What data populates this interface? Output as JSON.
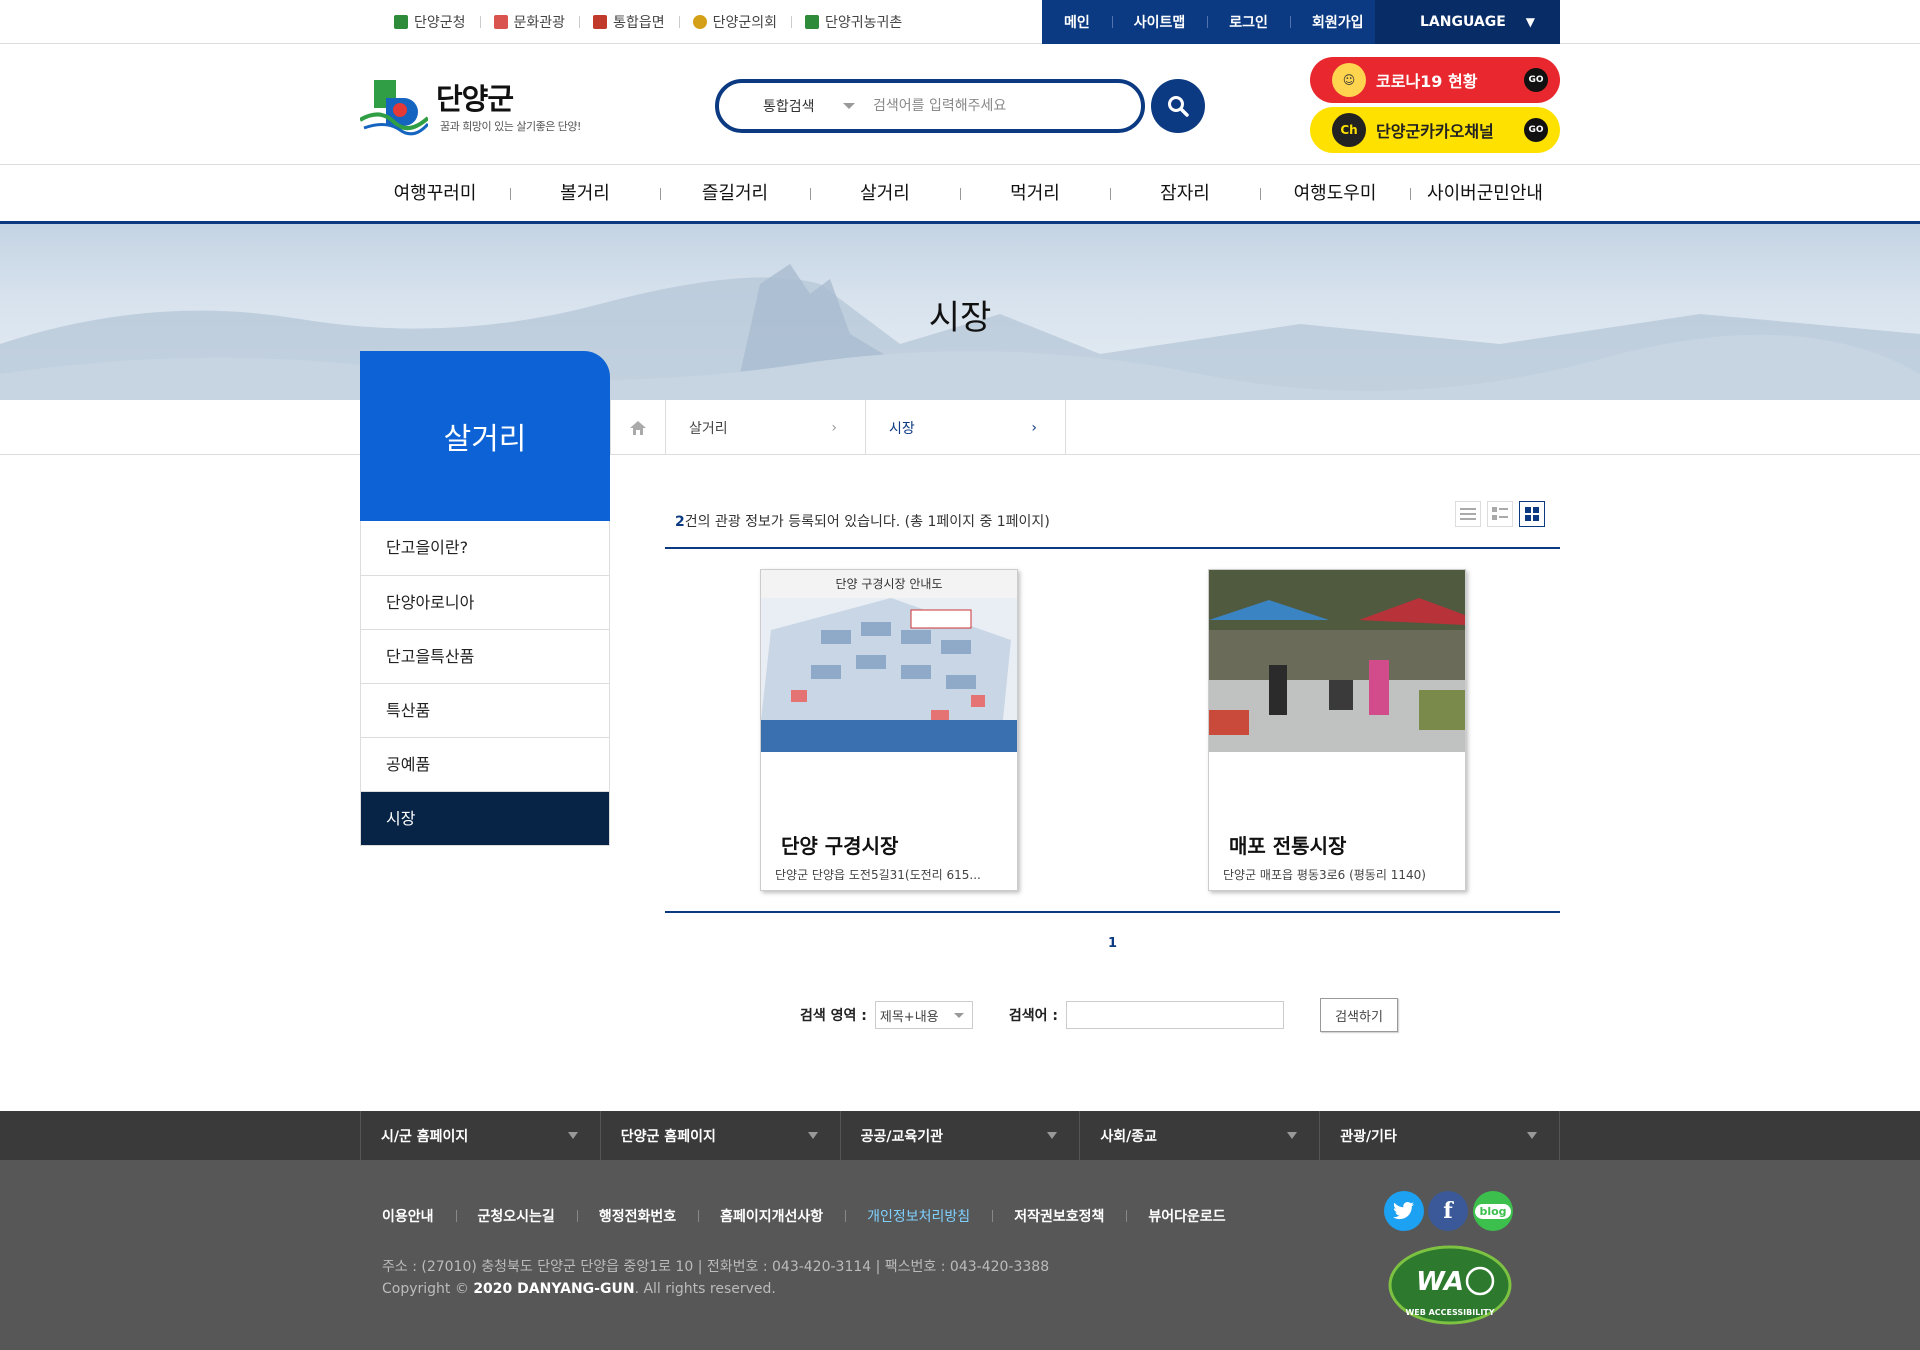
{
  "util": {
    "links": [
      {
        "label": "단양군청",
        "icon": "gov-icon",
        "color": "#2e8b3a"
      },
      {
        "label": "문화관광",
        "icon": "camera-icon",
        "color": "#d9534f"
      },
      {
        "label": "통합읍면",
        "icon": "signpost-icon",
        "color": "#c0392b"
      },
      {
        "label": "단양군의회",
        "icon": "emblem-icon",
        "color": "#d4a017"
      },
      {
        "label": "단양귀농귀촌",
        "icon": "house-icon",
        "color": "#2e8b3a"
      }
    ],
    "menu": [
      "메인",
      "사이트맵",
      "로그인",
      "회원가입"
    ],
    "language": "LANGUAGE"
  },
  "header": {
    "logo_name": "단양군",
    "slogan": "꿈과 희망이 있는 살기좋은 단양!",
    "search_category": "통합검색",
    "search_placeholder": "검색어를 입력해주세요",
    "banners": [
      {
        "label": "코로나19 현황",
        "go": "GO"
      },
      {
        "label": "단양군카카오채널",
        "go": "GO",
        "badge": "Ch"
      }
    ]
  },
  "gnb": [
    "여행꾸러미",
    "볼거리",
    "즐길거리",
    "살거리",
    "먹거리",
    "잠자리",
    "여행도우미",
    "사이버군민안내"
  ],
  "visual": {
    "title": "시장"
  },
  "lnb": {
    "title": "살거리",
    "items": [
      {
        "label": "단고을이란?",
        "active": false
      },
      {
        "label": "단양아로니아",
        "active": false
      },
      {
        "label": "단고을특산품",
        "active": false
      },
      {
        "label": "특산품",
        "active": false
      },
      {
        "label": "공예품",
        "active": false
      },
      {
        "label": "시장",
        "active": true
      }
    ]
  },
  "breadcrumb": [
    "살거리",
    "시장"
  ],
  "content": {
    "count_num": "2",
    "count_text": "건의 관광 정보가 등록되어 있습니다. (총 1페이지 중 1페이지)",
    "cards": [
      {
        "title": "단양 구경시장",
        "address": "단양군 단양읍 도전5길31(도전리 615...",
        "thumb_caption": "단양 구경시장 안내도"
      },
      {
        "title": "매포 전통시장",
        "address": "단양군 매포읍 평동3로6 (평동리 1140)"
      }
    ],
    "page": "1",
    "search": {
      "area_label": "검색 영역 :",
      "area_value": "제목+내용",
      "keyword_label": "검색어 :",
      "button": "검색하기"
    }
  },
  "footer": {
    "nav": [
      "시/군 홈페이지",
      "단양군 홈페이지",
      "공공/교육기관",
      "사회/종교",
      "관광/기타"
    ],
    "links": [
      "이용안내",
      "군청오시는길",
      "행정전화번호",
      "홈페이지개선사항",
      "개인정보처리방침",
      "저작권보호정책",
      "뷰어다운로드"
    ],
    "address": "주소 : (27010) 충청북도 단양군 단양읍 중앙1로 10 | 전화번호 : 043-420-3114 | 팩스번호 : 043-420-3388",
    "copyright_pre": "Copyright © ",
    "copyright_bold": "2020 DANYANG-GUN",
    "copyright_post": ". All rights reserved.",
    "sns": [
      "twitter-icon",
      "facebook-icon",
      "blog-icon"
    ],
    "blog_label": "blog",
    "wa_label": "WA",
    "wa_caption": "WEB ACCESSIBILITY"
  },
  "colors": {
    "primary": "#0b3a82",
    "lnb_head": "#0d63d6",
    "lnb_active": "#072447",
    "footer": "#575757"
  }
}
